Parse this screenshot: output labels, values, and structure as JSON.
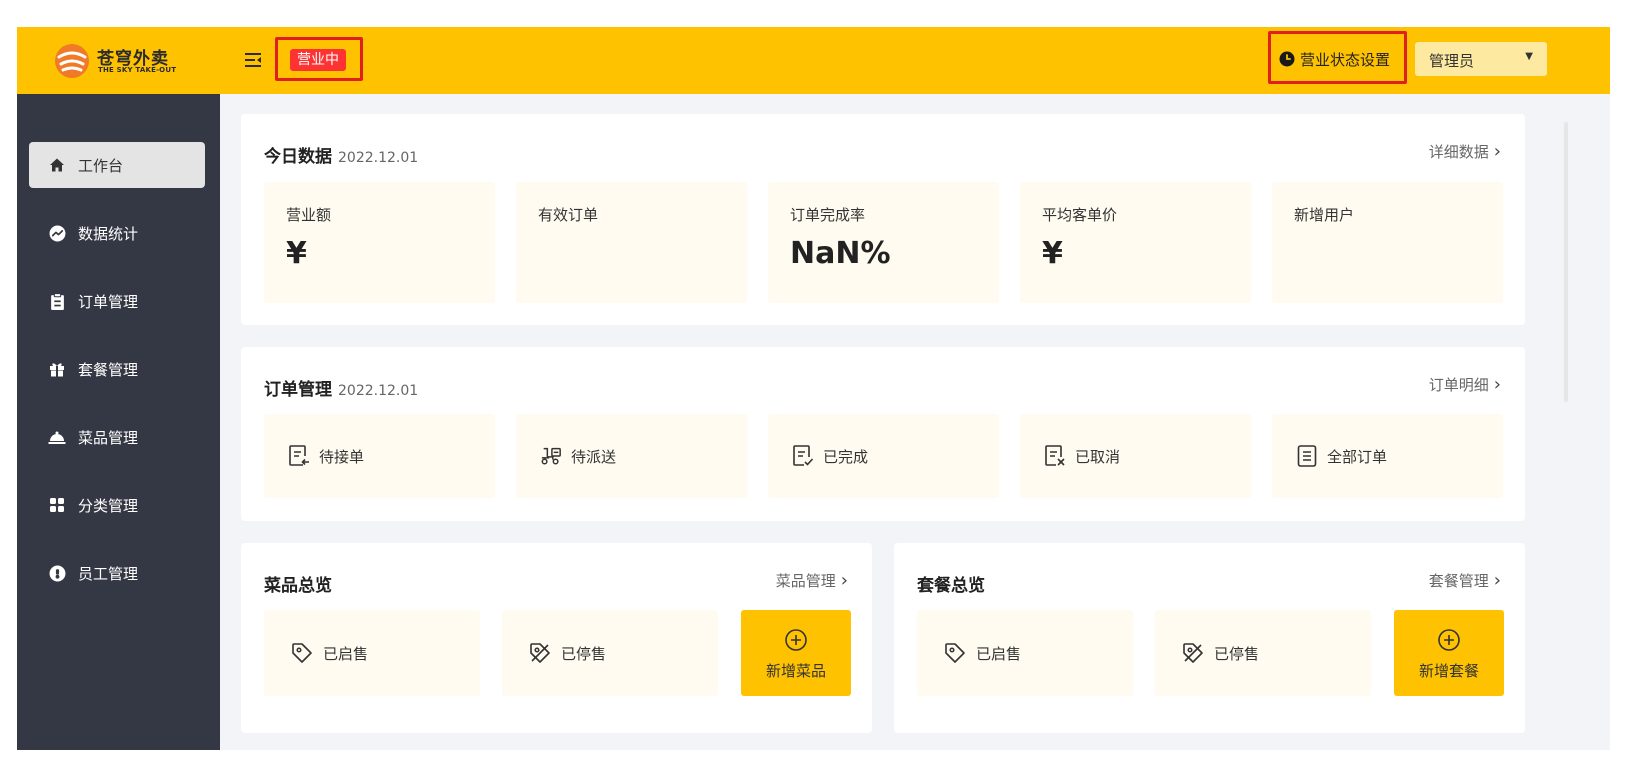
{
  "brand": {
    "name": "苍穹外卖",
    "tagline": "THE SKY TAKE-OUT"
  },
  "header": {
    "shop_status": "营业中",
    "status_setting": "营业状态设置",
    "user": "管理员"
  },
  "sidebar": {
    "items": [
      {
        "label": "工作台",
        "icon": "home-icon",
        "active": true
      },
      {
        "label": "数据统计",
        "icon": "chart-icon"
      },
      {
        "label": "订单管理",
        "icon": "clipboard-icon"
      },
      {
        "label": "套餐管理",
        "icon": "gift-icon"
      },
      {
        "label": "菜品管理",
        "icon": "cloche-icon"
      },
      {
        "label": "分类管理",
        "icon": "grid-icon"
      },
      {
        "label": "员工管理",
        "icon": "employee-icon"
      }
    ]
  },
  "today": {
    "title": "今日数据",
    "date": "2022.12.01",
    "link": "详细数据",
    "stats": [
      {
        "label": "营业额",
        "value": "¥"
      },
      {
        "label": "有效订单",
        "value": ""
      },
      {
        "label": "订单完成率",
        "value": "NaN%"
      },
      {
        "label": "平均客单价",
        "value": "¥"
      },
      {
        "label": "新增用户",
        "value": ""
      }
    ]
  },
  "orders": {
    "title": "订单管理",
    "date": "2022.12.01",
    "link": "订单明细",
    "items": [
      {
        "label": "待接单",
        "icon": "pending-order-icon"
      },
      {
        "label": "待派送",
        "icon": "delivery-icon"
      },
      {
        "label": "已完成",
        "icon": "completed-order-icon"
      },
      {
        "label": "已取消",
        "icon": "cancelled-order-icon"
      },
      {
        "label": "全部订单",
        "icon": "all-orders-icon"
      }
    ]
  },
  "dishes": {
    "title": "菜品总览",
    "link": "菜品管理",
    "on_sale": "已启售",
    "off_sale": "已停售",
    "add": "新增菜品"
  },
  "setmeals": {
    "title": "套餐总览",
    "link": "套餐管理",
    "on_sale": "已启售",
    "off_sale": "已停售",
    "add": "新增套餐"
  },
  "colors": {
    "accent": "#ffc200",
    "sidebar": "#343744",
    "badge": "#fd3333",
    "highlight_box": "#e02020",
    "tile": "#fffbf0"
  }
}
